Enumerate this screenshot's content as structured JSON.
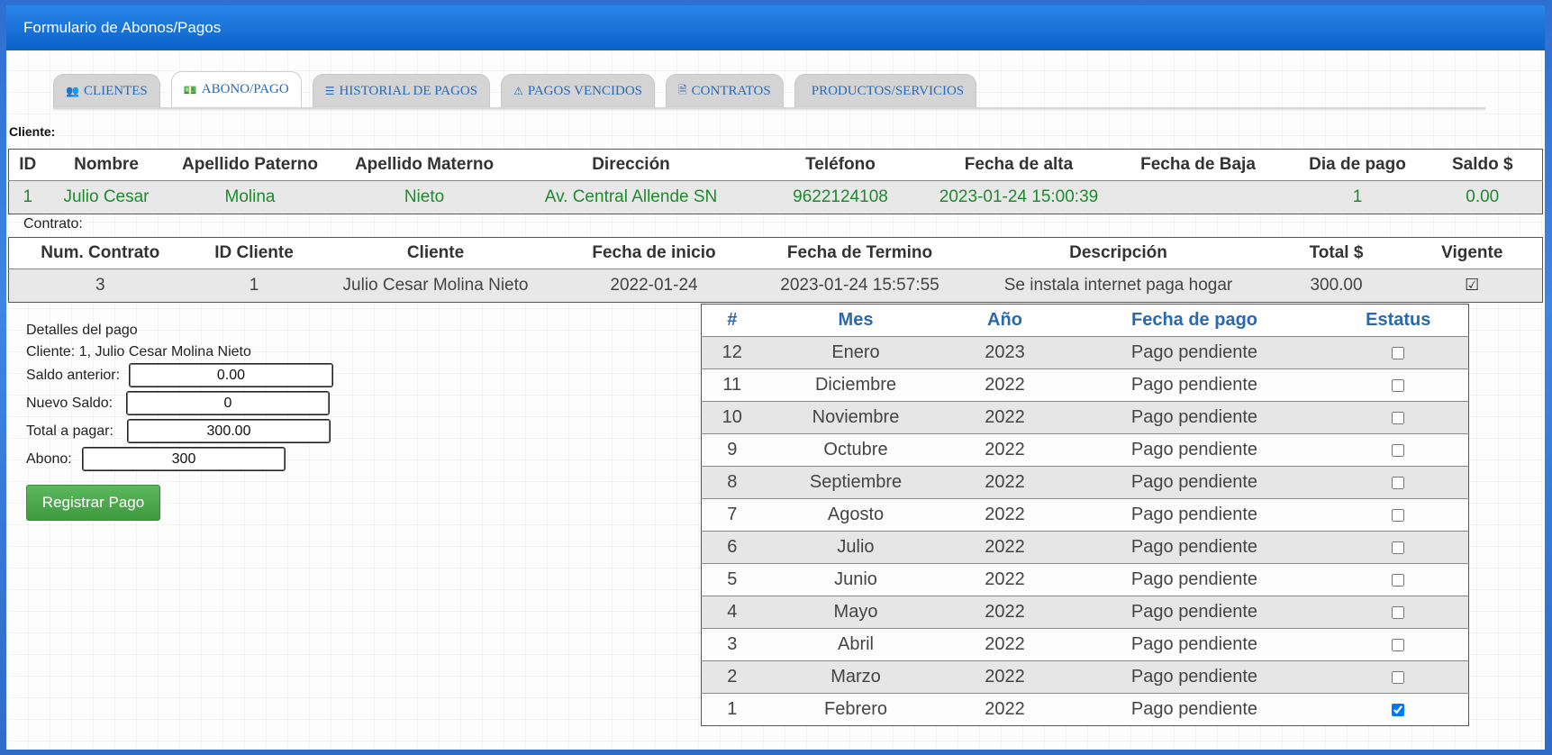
{
  "window": {
    "title": "Formulario de Abonos/Pagos"
  },
  "tabs": [
    {
      "label": "CLIENTES",
      "icon": "users-icon",
      "glyph": "👥",
      "active": false
    },
    {
      "label": "ABONO/PAGO",
      "icon": "money-icon",
      "glyph": "💵",
      "active": true
    },
    {
      "label": "HISTORIAL DE PAGOS",
      "icon": "list-icon",
      "glyph": "☰",
      "active": false
    },
    {
      "label": "PAGOS VENCIDOS",
      "icon": "warning-icon",
      "glyph": "⚠",
      "active": false
    },
    {
      "label": "CONTRATOS",
      "icon": "file-text-icon",
      "glyph": "🗎",
      "active": false
    },
    {
      "label": "PRODUCTOS/SERVICIOS",
      "icon": "apple-icon",
      "glyph": "",
      "active": false
    }
  ],
  "cliente_section": {
    "label": "Cliente:",
    "headers": [
      "ID",
      "Nombre",
      "Apellido Paterno",
      "Apellido Materno",
      "Dirección",
      "Teléfono",
      "Fecha de alta",
      "Fecha de Baja",
      "Dia de pago",
      "Saldo $"
    ],
    "row": [
      "1",
      "Julio Cesar",
      "Molina",
      "Nieto",
      "Av. Central Allende SN",
      "9622124108",
      "2023-01-24 15:00:39",
      "",
      "1",
      "0.00"
    ]
  },
  "contrato_section": {
    "label": "Contrato:",
    "headers": [
      "Num. Contrato",
      "ID Cliente",
      "Cliente",
      "Fecha de inicio",
      "Fecha de Termino",
      "Descripción",
      "Total $",
      "Vigente"
    ],
    "row": [
      "3",
      "1",
      "Julio Cesar Molina Nieto",
      "2022-01-24",
      "2023-01-24 15:57:55",
      "Se instala internet paga hogar",
      "300.00"
    ],
    "vigente_icon": "check-square-icon"
  },
  "detalles_pago": {
    "title": "Detalles del pago",
    "cliente_line": "Cliente: 1, Julio Cesar Molina Nieto",
    "saldo_anterior_label": "Saldo anterior:",
    "saldo_anterior_value": "0.00",
    "nuevo_saldo_label": "Nuevo Saldo:",
    "nuevo_saldo_value": "0",
    "total_pagar_label": "Total a pagar:",
    "total_pagar_value": "300.00",
    "abono_label": "Abono:",
    "abono_value": "300",
    "button_label": "Registrar Pago",
    "button_color": "#4cae4c"
  },
  "meses_table": {
    "headers": [
      "#",
      "Mes",
      "Año",
      "Fecha de pago",
      "Estatus"
    ],
    "rows": [
      {
        "num": "12",
        "mes": "Enero",
        "anio": "2023",
        "fecha": "Pago pendiente",
        "checked": false
      },
      {
        "num": "11",
        "mes": "Diciembre",
        "anio": "2022",
        "fecha": "Pago pendiente",
        "checked": false
      },
      {
        "num": "10",
        "mes": "Noviembre",
        "anio": "2022",
        "fecha": "Pago pendiente",
        "checked": false
      },
      {
        "num": "9",
        "mes": "Octubre",
        "anio": "2022",
        "fecha": "Pago pendiente",
        "checked": false
      },
      {
        "num": "8",
        "mes": "Septiembre",
        "anio": "2022",
        "fecha": "Pago pendiente",
        "checked": false
      },
      {
        "num": "7",
        "mes": "Agosto",
        "anio": "2022",
        "fecha": "Pago pendiente",
        "checked": false
      },
      {
        "num": "6",
        "mes": "Julio",
        "anio": "2022",
        "fecha": "Pago pendiente",
        "checked": false
      },
      {
        "num": "5",
        "mes": "Junio",
        "anio": "2022",
        "fecha": "Pago pendiente",
        "checked": false
      },
      {
        "num": "4",
        "mes": "Mayo",
        "anio": "2022",
        "fecha": "Pago pendiente",
        "checked": false
      },
      {
        "num": "3",
        "mes": "Abril",
        "anio": "2022",
        "fecha": "Pago pendiente",
        "checked": false
      },
      {
        "num": "2",
        "mes": "Marzo",
        "anio": "2022",
        "fecha": "Pago pendiente",
        "checked": false
      },
      {
        "num": "1",
        "mes": "Febrero",
        "anio": "2022",
        "fecha": "Pago pendiente",
        "checked": true
      }
    ]
  },
  "colors": {
    "titlebar": "#0b62c9",
    "tab_text": "#2b6ab4",
    "client_row_text": "#1e8a2e",
    "month_header_text": "#2a68b0"
  }
}
